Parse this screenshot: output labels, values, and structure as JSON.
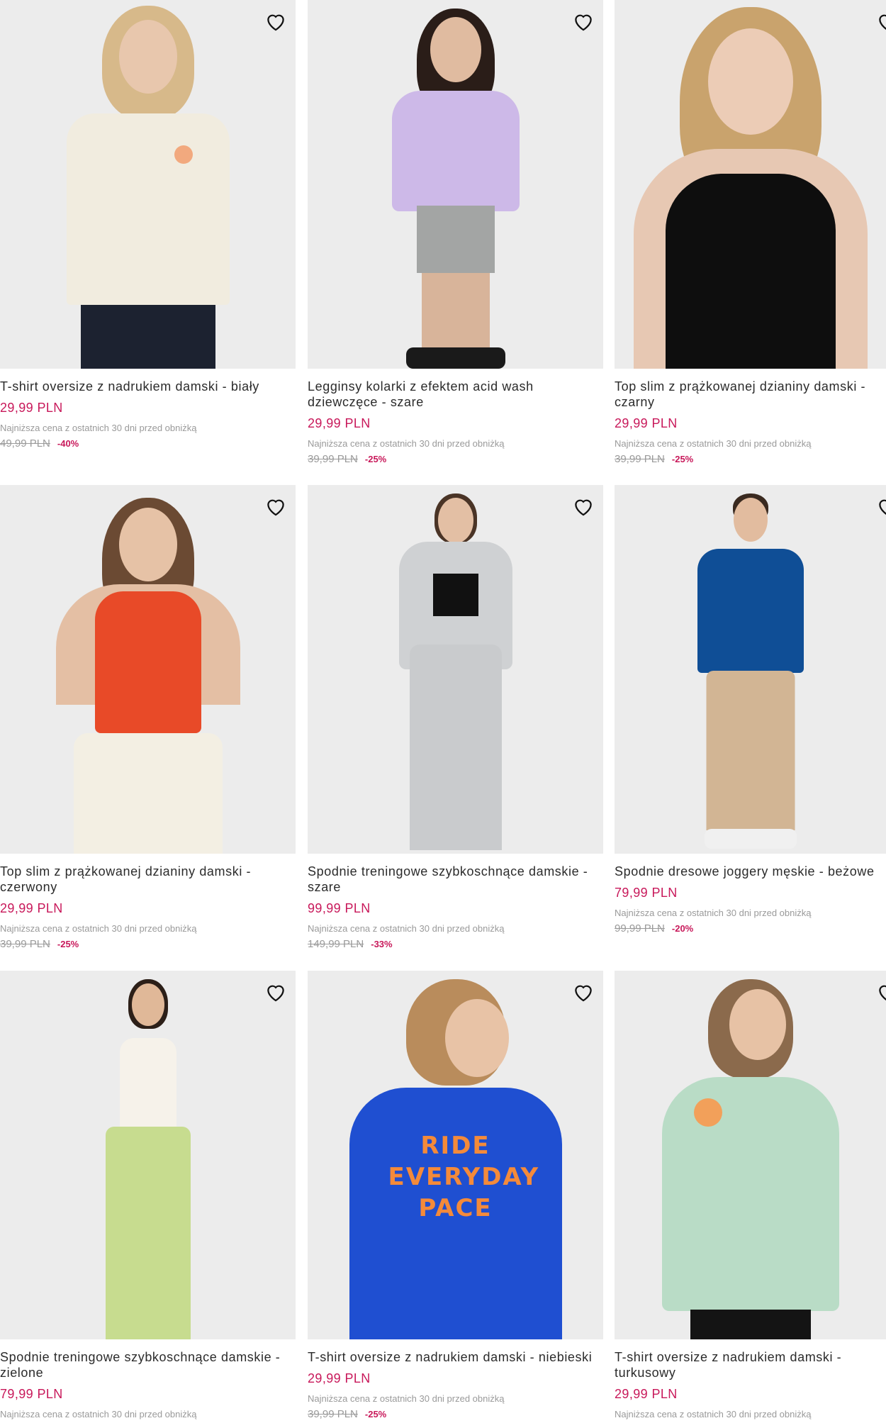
{
  "wishlist_icon": "heart-outline-icon",
  "colors": {
    "price": "#c8185a",
    "muted": "#9a9a9a",
    "image_bg": "#ececec"
  },
  "products": [
    {
      "title": "T-shirt oversize z nadrukiem damski - biały",
      "price": "29,99 PLN",
      "lowest_label": "Najniższa cena z ostatnich 30 dni przed obniżką",
      "old_price": "49,99 PLN",
      "discount": "-40%"
    },
    {
      "title": "Legginsy kolarki z efektem acid wash dziewczęce - szare",
      "price": "29,99 PLN",
      "lowest_label": "Najniższa cena z ostatnich 30 dni przed obniżką",
      "old_price": "39,99 PLN",
      "discount": "-25%"
    },
    {
      "title": "Top slim z prążkowanej dzianiny damski - czarny",
      "price": "29,99 PLN",
      "lowest_label": "Najniższa cena z ostatnich 30 dni przed obniżką",
      "old_price": "39,99 PLN",
      "discount": "-25%"
    },
    {
      "title": "Top slim z prążkowanej dzianiny damski - czerwony",
      "price": "29,99 PLN",
      "lowest_label": "Najniższa cena z ostatnich 30 dni przed obniżką",
      "old_price": "39,99 PLN",
      "discount": "-25%"
    },
    {
      "title": "Spodnie treningowe szybkoschnące damskie - szare",
      "price": "99,99 PLN",
      "lowest_label": "Najniższa cena z ostatnich 30 dni przed obniżką",
      "old_price": "149,99 PLN",
      "discount": "-33%"
    },
    {
      "title": "Spodnie dresowe joggery męskie - beżowe",
      "price": "79,99 PLN",
      "lowest_label": "Najniższa cena z ostatnich 30 dni przed obniżką",
      "old_price": "99,99 PLN",
      "discount": "-20%"
    },
    {
      "title": "Spodnie treningowe szybkoschnące damskie - zielone",
      "price": "79,99 PLN",
      "lowest_label": "Najniższa cena z ostatnich 30 dni przed obniżką",
      "old_price": "",
      "discount": ""
    },
    {
      "title": "T-shirt oversize z nadrukiem damski - niebieski",
      "price": "29,99 PLN",
      "lowest_label": "Najniższa cena z ostatnich 30 dni przed obniżką",
      "old_price": "39,99 PLN",
      "discount": "-25%",
      "print_text": "RIDE EVERYDAY PACE"
    },
    {
      "title": "T-shirt oversize z nadrukiem damski - turkusowy",
      "price": "29,99 PLN",
      "lowest_label": "Najniższa cena z ostatnich 30 dni przed obniżką",
      "old_price": "",
      "discount": ""
    }
  ]
}
